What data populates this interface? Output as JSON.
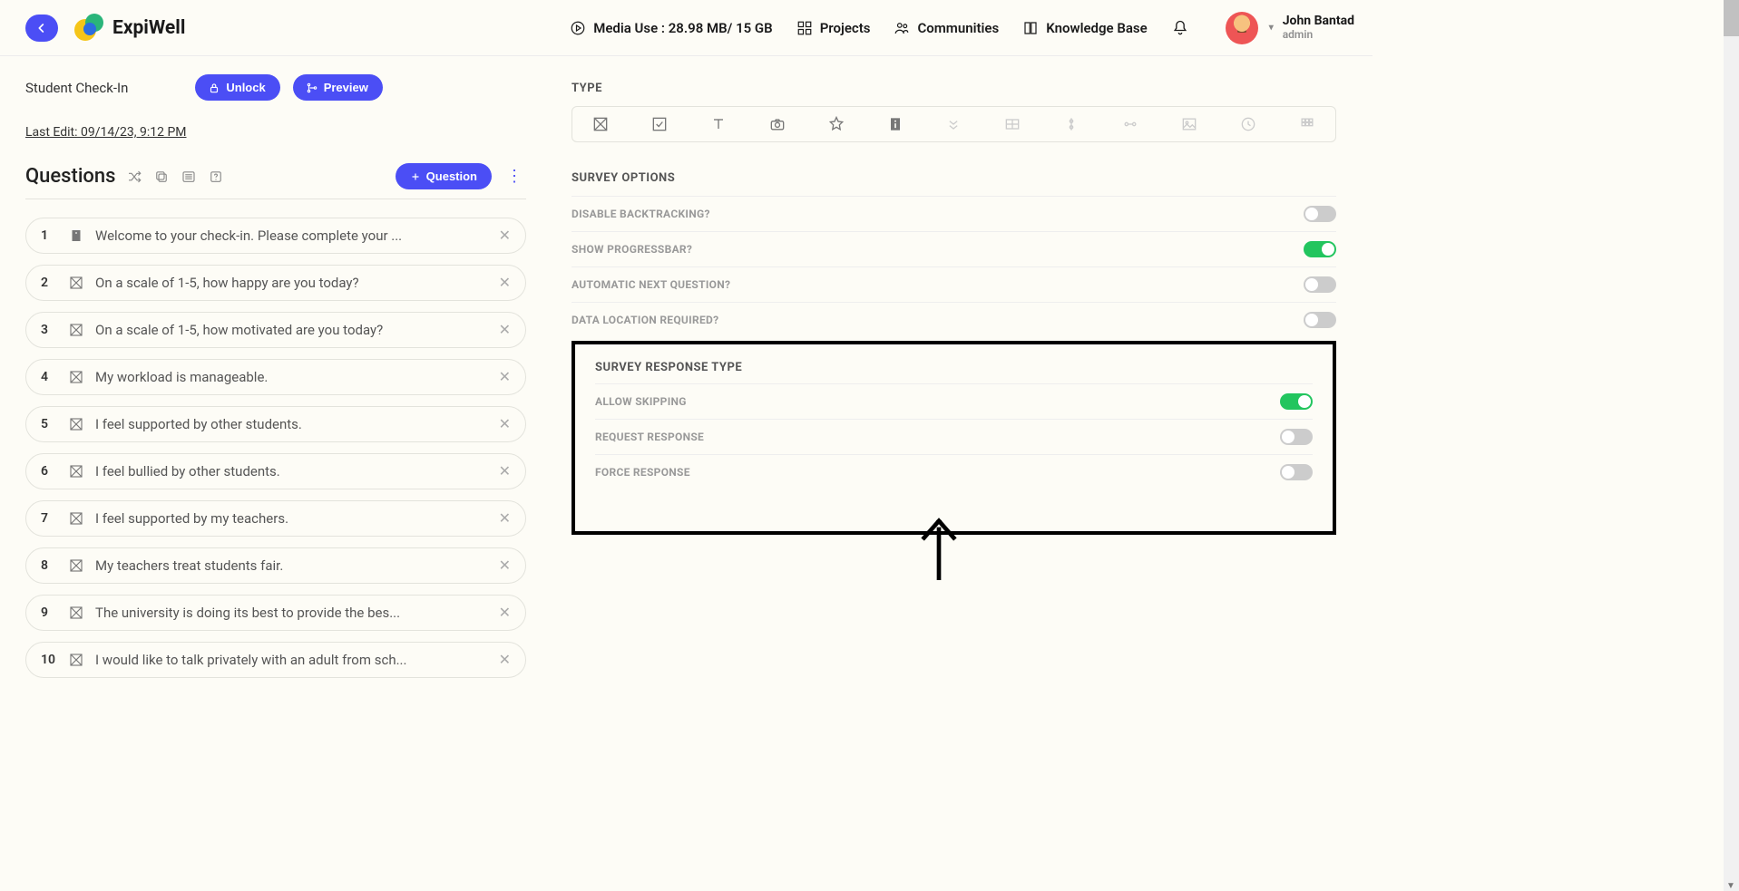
{
  "header": {
    "brand": "ExpiWell",
    "media_use": "Media Use : 28.98 MB/ 15 GB",
    "nav": {
      "projects": "Projects",
      "communities": "Communities",
      "knowledge_base": "Knowledge Base"
    },
    "user": {
      "name": "John Bantad",
      "role": "admin"
    }
  },
  "left": {
    "project_title": "Student Check-In",
    "unlock_label": "Unlock",
    "preview_label": "Preview",
    "last_edit": "Last Edit: 09/14/23, 9:12 PM",
    "questions_heading": "Questions",
    "add_question_label": "Question"
  },
  "questions": [
    {
      "n": "1",
      "type": "info",
      "text": "Welcome to your check-in. Please complete your ..."
    },
    {
      "n": "2",
      "type": "single",
      "text": "On a scale of 1-5, how happy are you today?"
    },
    {
      "n": "3",
      "type": "single",
      "text": "On a scale of 1-5, how motivated are you today?"
    },
    {
      "n": "4",
      "type": "single",
      "text": "My workload is manageable."
    },
    {
      "n": "5",
      "type": "single",
      "text": "I feel supported by other students."
    },
    {
      "n": "6",
      "type": "single",
      "text": "I feel bullied by other students."
    },
    {
      "n": "7",
      "type": "single",
      "text": "I feel supported by my teachers."
    },
    {
      "n": "8",
      "type": "single",
      "text": "My teachers treat students fair."
    },
    {
      "n": "9",
      "type": "single",
      "text": "The university is doing its best to provide the bes..."
    },
    {
      "n": "10",
      "type": "single",
      "text": "I would like to talk privately with an adult from sch..."
    }
  ],
  "right": {
    "type_label": "TYPE",
    "survey_options_label": "SURVEY OPTIONS",
    "options": {
      "disable_backtracking": {
        "label": "DISABLE BACKTRACKING?",
        "on": false
      },
      "show_progressbar": {
        "label": "SHOW PROGRESSBAR?",
        "on": true
      },
      "automatic_next": {
        "label": "AUTOMATIC NEXT QUESTION?",
        "on": false
      },
      "data_location": {
        "label": "DATA LOCATION REQUIRED?",
        "on": false
      }
    },
    "response_type_label": "SURVEY RESPONSE TYPE",
    "response_options": {
      "allow_skipping": {
        "label": "ALLOW SKIPPING",
        "on": true
      },
      "request_response": {
        "label": "REQUEST RESPONSE",
        "on": false
      },
      "force_response": {
        "label": "FORCE RESPONSE",
        "on": false
      }
    }
  }
}
